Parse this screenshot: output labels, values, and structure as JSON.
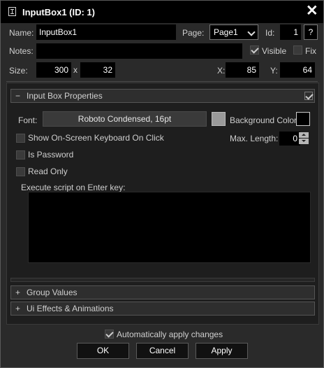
{
  "window": {
    "title": "InputBox1 (ID: 1)",
    "close_glyph": "✕"
  },
  "general": {
    "name_label": "Name:",
    "name_value": "InputBox1",
    "page_label": "Page:",
    "page_value": "Page1",
    "id_label": "Id:",
    "id_value": "1",
    "help_label": "?",
    "notes_label": "Notes:",
    "notes_value": "",
    "visible_label": "Visible",
    "visible_checked": true,
    "fix_label": "Fix",
    "fix_checked": false,
    "size_label": "Size:",
    "width_value": "300",
    "size_sep": "x",
    "height_value": "32",
    "x_label": "X:",
    "x_value": "85",
    "y_label": "Y:",
    "y_value": "64"
  },
  "properties": {
    "section_sign": "−",
    "section_title": "Input Box Properties",
    "font_label": "Font:",
    "font_value": "Roboto Condensed, 16pt",
    "font_color": "#9a9a9a",
    "bg_color_label": "Background Color:",
    "bg_color": "#000000",
    "keyboard_label": "Show On-Screen Keyboard On Click",
    "max_length_label": "Max. Length:",
    "max_length_value": "0",
    "password_label": "Is Password",
    "readonly_label": "Read Only",
    "script_label": "Execute script on Enter key:"
  },
  "collapsed_sections": [
    {
      "sign": "+",
      "title": "Group Values"
    },
    {
      "sign": "+",
      "title": "Ui Effects & Animations"
    }
  ],
  "footer": {
    "auto_apply_label": "Automatically apply changes",
    "auto_apply_checked": true,
    "ok_label": "OK",
    "cancel_label": "Cancel",
    "apply_label": "Apply"
  }
}
